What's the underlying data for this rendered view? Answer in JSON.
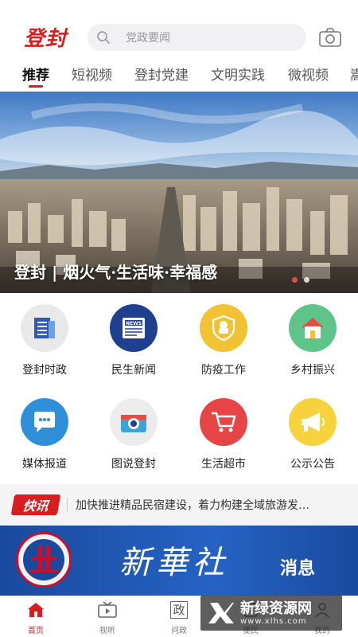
{
  "header": {
    "logo": "登封",
    "search_placeholder": "党政要闻"
  },
  "tabs": [
    {
      "label": "推荐",
      "active": true
    },
    {
      "label": "短视频"
    },
    {
      "label": "登封党建"
    },
    {
      "label": "文明实践"
    },
    {
      "label": "微视频"
    },
    {
      "label": "嵩"
    }
  ],
  "banner": {
    "caption": "登封 | 烟火气·生活味·幸福感",
    "slides": 2,
    "active_slide": 0
  },
  "grid": [
    {
      "label": "登封时政",
      "icon": "newspaper-icon",
      "color": "#e9e9e9"
    },
    {
      "label": "民生新闻",
      "icon": "news-icon",
      "color": "#1f3f8f"
    },
    {
      "label": "防疫工作",
      "icon": "mask-shield-icon",
      "color": "#f1c232"
    },
    {
      "label": "乡村振兴",
      "icon": "house-icon",
      "color": "#5fc48a"
    },
    {
      "label": "媒体报道",
      "icon": "chat-bubble-icon",
      "color": "#2f8fd8"
    },
    {
      "label": "图说登封",
      "icon": "camera-icon",
      "color": "#ececec"
    },
    {
      "label": "生活超市",
      "icon": "shopping-cart-icon",
      "color": "#e64545"
    },
    {
      "label": "公示公告",
      "icon": "megaphone-icon",
      "color": "#f6d23c"
    }
  ],
  "flash": {
    "tag": "快讯",
    "text": "加快推进精品民宿建设，着力构建全域旅游发…"
  },
  "xinhua": {
    "title": "新華社",
    "subtitle": "消息"
  },
  "bottom_nav": [
    {
      "label": "首页",
      "icon": "home-icon",
      "active": true
    },
    {
      "label": "视听",
      "icon": "tv-icon"
    },
    {
      "label": "问政",
      "icon": "zheng-icon",
      "glyph": "政"
    },
    {
      "label": "便民",
      "icon": "service-icon"
    },
    {
      "label": "我的",
      "icon": "user-icon"
    }
  ],
  "watermark": {
    "title": "新绿资源网",
    "url": "www.xlhs.com"
  },
  "colors": {
    "brand_red": "#d81e1e"
  }
}
